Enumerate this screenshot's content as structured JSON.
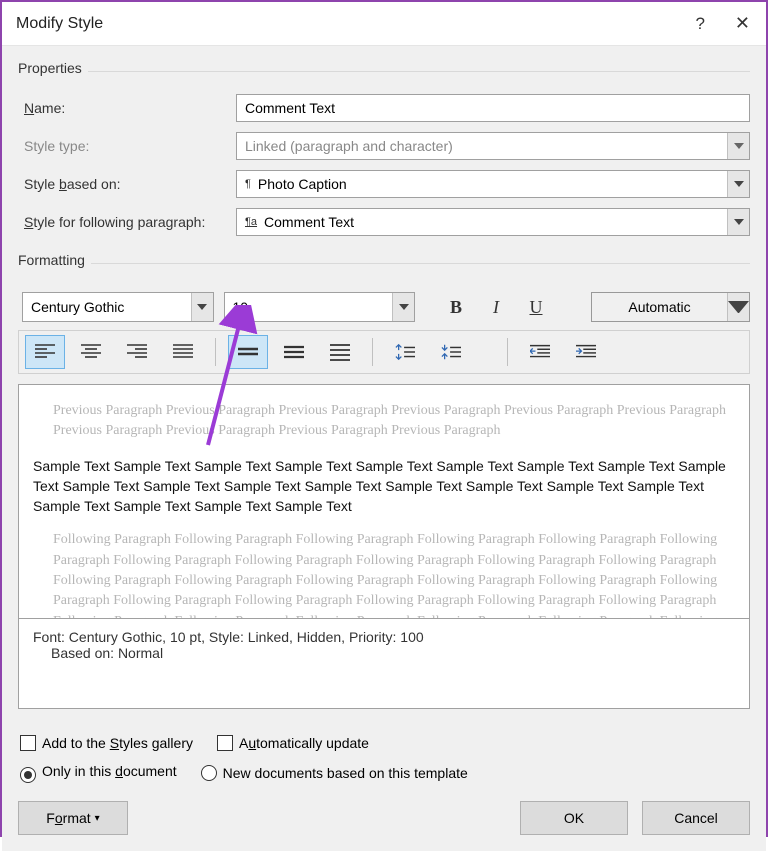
{
  "title": "Modify Style",
  "properties": {
    "section": "Properties",
    "name_label": "Name:",
    "name_value": "Comment Text",
    "style_type_label": "Style type:",
    "style_type_value": "Linked (paragraph and character)",
    "based_on_label": "Style based on:",
    "based_on_value": "Photo Caption",
    "following_label": "Style for following paragraph:",
    "following_value": "Comment Text"
  },
  "formatting": {
    "section": "Formatting",
    "font": "Century Gothic",
    "size": "10",
    "color": "Automatic",
    "bold": "B",
    "italic": "I",
    "underline": "U"
  },
  "preview": {
    "prev_para": "Previous Paragraph Previous Paragraph Previous Paragraph Previous Paragraph Previous Paragraph Previous Paragraph Previous Paragraph Previous Paragraph Previous Paragraph Previous Paragraph",
    "sample": "Sample Text Sample Text Sample Text Sample Text Sample Text Sample Text Sample Text Sample Text Sample Text Sample Text Sample Text Sample Text Sample Text Sample Text Sample Text Sample Text Sample Text Sample Text Sample Text Sample Text Sample Text",
    "next_para": "Following Paragraph Following Paragraph Following Paragraph Following Paragraph Following Paragraph Following Paragraph Following Paragraph Following Paragraph Following Paragraph Following Paragraph Following Paragraph Following Paragraph Following Paragraph Following Paragraph Following Paragraph Following Paragraph Following Paragraph Following Paragraph Following Paragraph Following Paragraph Following Paragraph Following Paragraph Following Paragraph Following Paragraph Following Paragraph Following Paragraph Following Paragraph Following Paragraph Following Paragraph Following Paragraph Following Paragraph Following Paragraph Following Paragraph Following Paragraph Following Paragraph"
  },
  "description": {
    "line1": "Font: Century Gothic, 10 pt, Style: Linked, Hidden, Priority: 100",
    "line2": "Based on: Normal"
  },
  "checks": {
    "add_gallery": "Add to the Styles gallery",
    "auto_update": "Automatically update",
    "only_doc": "Only in this document",
    "new_docs": "New documents based on this template"
  },
  "buttons": {
    "format": "Format",
    "ok": "OK",
    "cancel": "Cancel"
  }
}
